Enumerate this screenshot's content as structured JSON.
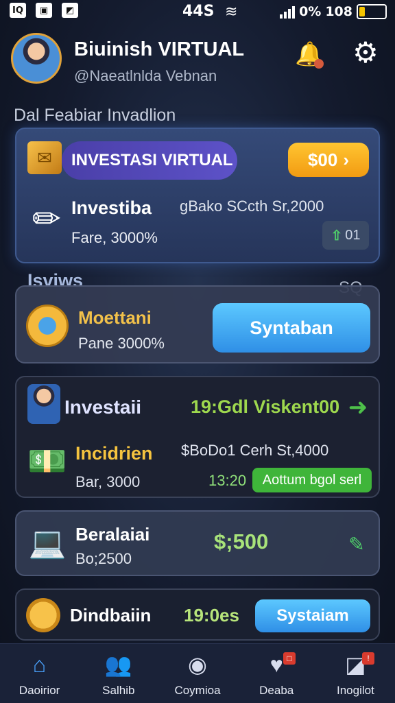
{
  "status_bar": {
    "left_icons": [
      "notification-icon",
      "image-icon",
      "navigation-icon"
    ],
    "left_glyphs": [
      "IQ",
      "▣",
      "◩"
    ],
    "time": "44S",
    "battery": "0%",
    "extra": "108"
  },
  "header": {
    "title": "Biuinish VIRTUAL",
    "subtitle": "@Naeatlnlda Vebnan"
  },
  "section_label": "Dal Feabiar Invadlion",
  "card1": {
    "pill_label": "INVESTASI VIRTUAL",
    "button_label": "$00",
    "button_arrow": "›",
    "name": "Investiba",
    "rate": "Fare, 3000%",
    "balance": "gBako SCcth Sr,2000",
    "chip_value": "01",
    "chip_arrow": "⇧"
  },
  "section2": {
    "label": "Isviws",
    "icon": "SQ"
  },
  "card2": {
    "name": "Moettani",
    "rate": "Pane 3000%",
    "button_label": "Syntaban"
  },
  "card3": {
    "name": "Investaii",
    "value": "19:Gdl Viskent00",
    "arrow": "➜",
    "sub_name": "Incidrien",
    "sub_balance": "Bar, 3000",
    "right_balance": "$BoDo1 Cerh St,4000",
    "time": "13:20",
    "button_label": "Aottum bgol serl"
  },
  "card4": {
    "name": "Beralaiai",
    "amount": "Bo;2500",
    "value": "$;500",
    "edit_icon": "✎"
  },
  "card5": {
    "name": "Dindbaiin",
    "time": "19:0es",
    "button_label": "Systaiam"
  },
  "nav": {
    "items": [
      {
        "label": "Daoirior",
        "icon": "home-icon",
        "glyph": "⌂"
      },
      {
        "label": "Salhib",
        "icon": "users-icon",
        "glyph": "👥"
      },
      {
        "label": "Coymioa",
        "icon": "profile-icon",
        "glyph": "◉"
      },
      {
        "label": "Deaba",
        "icon": "wallet-icon",
        "glyph": "♥",
        "badge": "□"
      },
      {
        "label": "Inogilot",
        "icon": "chart-icon",
        "glyph": "◪",
        "badge": "!"
      }
    ]
  }
}
